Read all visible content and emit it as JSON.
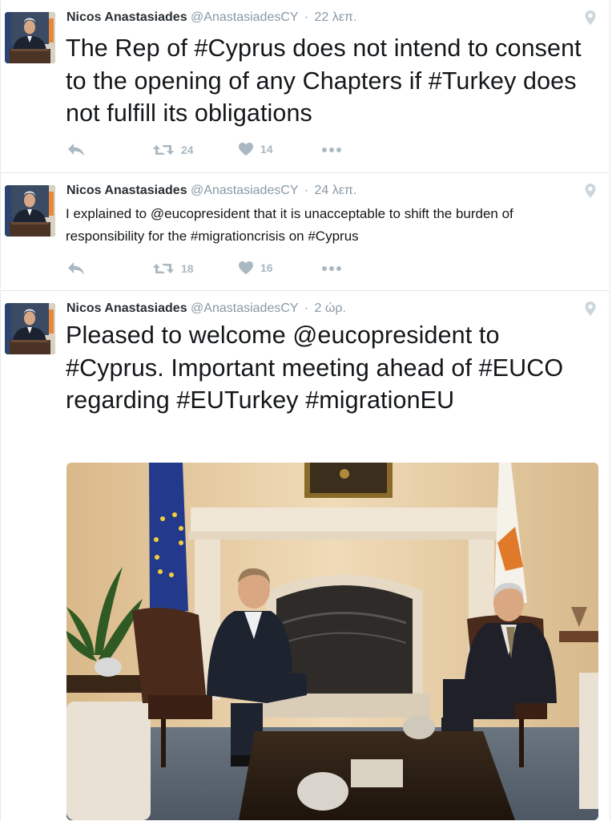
{
  "tweets": [
    {
      "name": "Nicos Anastasiades",
      "handle": "@AnastasiadesCY",
      "separator": "·",
      "time": "22 λεπ.",
      "text": "The Rep of #Cyprus does not intend to consent to the opening of any Chapters if #Turkey does not fulfill its obligations",
      "retweets": "24",
      "likes": "14"
    },
    {
      "name": "Nicos Anastasiades",
      "handle": "@AnastasiadesCY",
      "separator": "·",
      "time": "24 λεπ.",
      "text": "I explained to @eucopresident  that it is unacceptable to shift the burden of responsibility for the #migrationcrisis on #Cyprus",
      "retweets": "18",
      "likes": "16"
    },
    {
      "name": "Nicos Anastasiades",
      "handle": "@AnastasiadesCY",
      "separator": "·",
      "time": "2 ώρ.",
      "text": "Pleased to welcome @eucopresident to #Cyprus. Important meeting ahead of #EUCO regarding #EUTurkey #migrationEU"
    }
  ],
  "icons": {
    "reply": "reply-icon",
    "retweet": "retweet-icon",
    "like": "heart-icon",
    "more": "more-icon",
    "geo": "location-pin-icon"
  },
  "colors": {
    "icon_gray": "#aab8c2",
    "border": "#e1e8ed",
    "text": "#14171a",
    "meta": "#8899a6"
  }
}
